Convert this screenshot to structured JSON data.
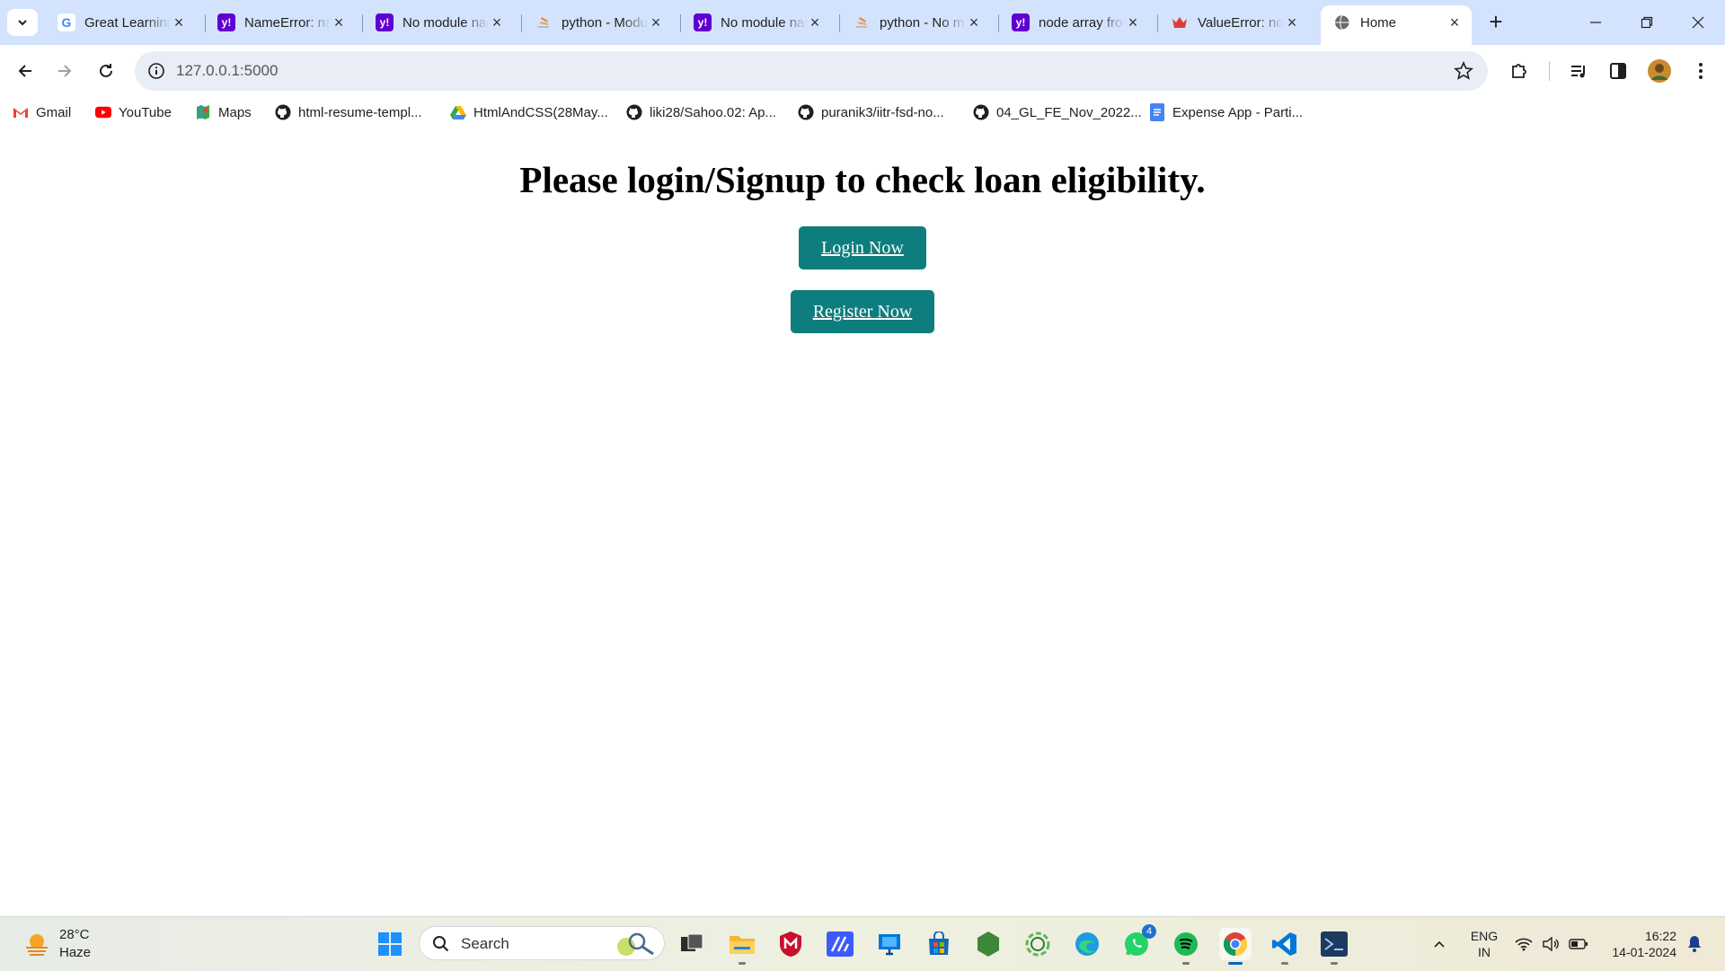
{
  "browser": {
    "tabs": [
      {
        "title": "Great Learning",
        "favicon": "google-icon",
        "active": false
      },
      {
        "title": "NameError: name",
        "favicon": "yahoo-icon",
        "active": false
      },
      {
        "title": "No module named",
        "favicon": "yahoo-icon",
        "active": false
      },
      {
        "title": "python - Modu",
        "favicon": "stackoverflow-icon",
        "active": false
      },
      {
        "title": "No module named",
        "favicon": "yahoo-icon",
        "active": false
      },
      {
        "title": "python - No m",
        "favicon": "stackoverflow-icon",
        "active": false
      },
      {
        "title": "node array from",
        "favicon": "yahoo-icon",
        "active": false
      },
      {
        "title": "ValueError: no",
        "favicon": "crown-icon",
        "active": false
      },
      {
        "title": "Home",
        "favicon": "globe-icon",
        "active": true
      }
    ],
    "url": "127.0.0.1:5000",
    "bookmarks": [
      {
        "label": "Gmail",
        "icon": "gmail-icon"
      },
      {
        "label": "YouTube",
        "icon": "youtube-icon"
      },
      {
        "label": "Maps",
        "icon": "maps-icon"
      },
      {
        "label": "html-resume-templ...",
        "icon": "github-icon"
      },
      {
        "label": "HtmlAndCSS(28May...",
        "icon": "drive-icon"
      },
      {
        "label": "liki28/Sahoo.02: Ap...",
        "icon": "github-icon"
      },
      {
        "label": "puranik3/iitr-fsd-no...",
        "icon": "github-icon"
      },
      {
        "label": "04_GL_FE_Nov_2022...",
        "icon": "github-icon"
      },
      {
        "label": "Expense App - Parti...",
        "icon": "docs-icon"
      }
    ]
  },
  "page": {
    "heading": "Please login/Signup to check loan eligibility.",
    "login_label": "Login Now",
    "register_label": "Register Now",
    "button_color": "#0e7d7d"
  },
  "taskbar": {
    "weather": {
      "temp": "28°C",
      "condition": "Haze"
    },
    "search_placeholder": "Search",
    "whatsapp_badge": "4",
    "language": {
      "line1": "ENG",
      "line2": "IN"
    },
    "time": "16:22",
    "date": "14-01-2024"
  }
}
